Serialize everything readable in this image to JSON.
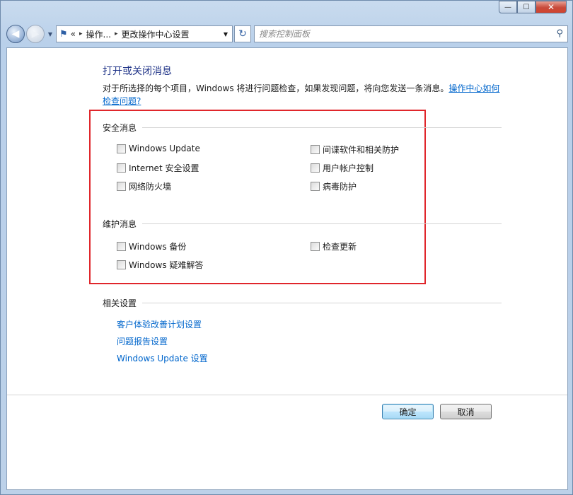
{
  "window": {
    "minimize_glyph": "—",
    "maximize_glyph": "☐",
    "close_glyph": "✕"
  },
  "navbar": {
    "back_glyph": "◀",
    "forward_glyph": "▶",
    "history_dropdown_glyph": "▼",
    "breadcrumb_overflow": "«",
    "breadcrumb": [
      "操作...",
      "更改操作中心设置"
    ],
    "breadcrumb_separator": "▸",
    "address_dropdown_glyph": "▼",
    "refresh_glyph": "↻",
    "search_placeholder": "搜索控制面板",
    "search_icon_glyph": "⚲"
  },
  "page": {
    "title": "打开或关闭消息",
    "description": "对于所选择的每个项目，Windows 将进行问题检查，如果发现问题，将向您发送一条消息。",
    "description_link": "操作中心如何检查问题?"
  },
  "security": {
    "heading": "安全消息",
    "items": [
      {
        "label": "Windows Update",
        "checked": false
      },
      {
        "label": "间谍软件和相关防护",
        "checked": false
      },
      {
        "label": "Internet 安全设置",
        "checked": false
      },
      {
        "label": "用户帐户控制",
        "checked": false
      },
      {
        "label": "网络防火墙",
        "checked": false
      },
      {
        "label": "病毒防护",
        "checked": false
      }
    ]
  },
  "maintenance": {
    "heading": "维护消息",
    "items": [
      {
        "label": "Windows 备份",
        "checked": false
      },
      {
        "label": "检查更新",
        "checked": false
      },
      {
        "label": "Windows 疑难解答",
        "checked": false
      }
    ]
  },
  "related": {
    "heading": "相关设置",
    "links": [
      "客户体验改善计划设置",
      "问题报告设置",
      "Windows Update 设置"
    ]
  },
  "buttons": {
    "ok": "确定",
    "cancel": "取消"
  },
  "colors": {
    "title": "#1e3287",
    "link": "#0066cc",
    "highlight_border": "#e0262b"
  }
}
